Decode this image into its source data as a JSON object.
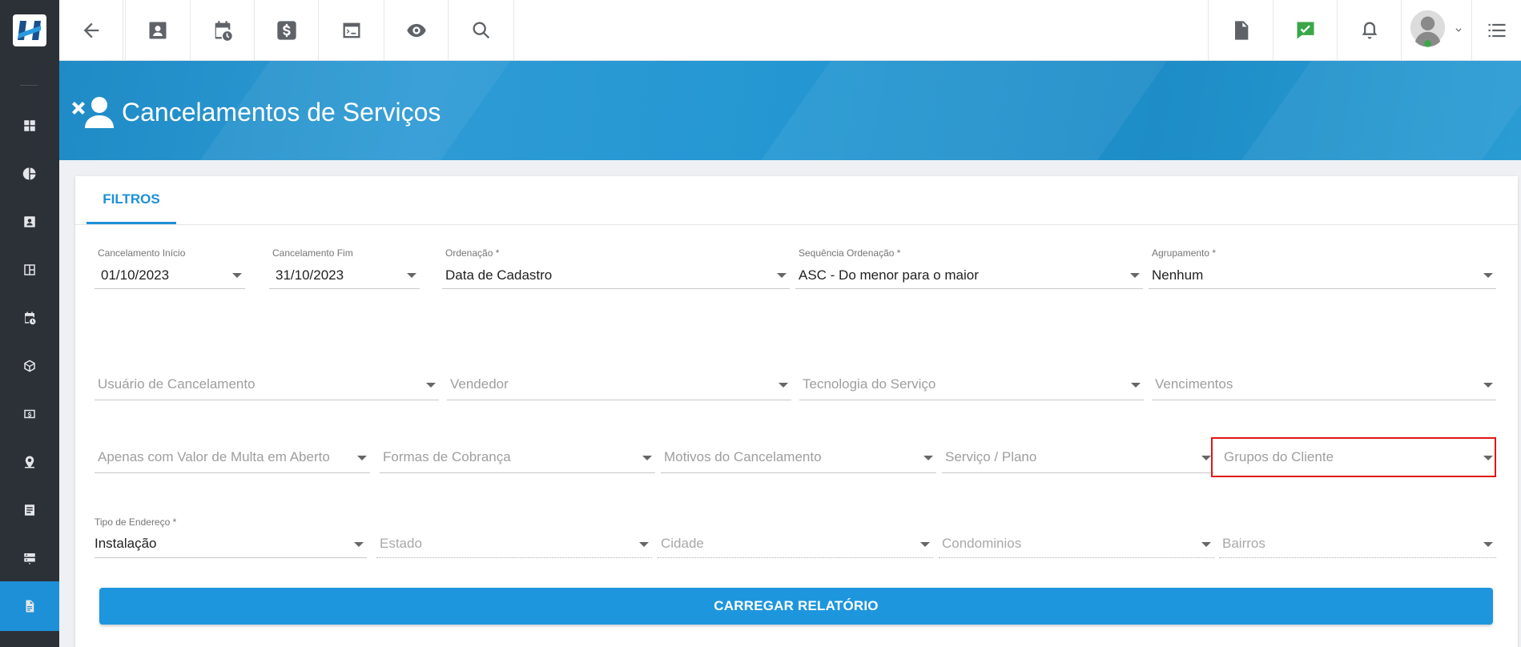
{
  "app": {
    "title": "Cancelamentos de Serviços"
  },
  "topbar": {
    "icons": [
      "back-arrow-icon",
      "contact-card-icon",
      "calendar-clock-icon",
      "dollar-icon",
      "terminal-icon",
      "eye-icon",
      "search-icon",
      "pdf-icon",
      "check-message-icon",
      "bell-icon",
      "avatar",
      "menu-list-icon"
    ]
  },
  "sidebar": {
    "items": [
      "dashboard-icon",
      "pie-chart-icon",
      "contact-card-icon",
      "board-icon",
      "calendar-clock-icon",
      "package-icon",
      "money-icon",
      "location-pin-icon",
      "document-list-icon",
      "server-icon",
      "report-file-icon"
    ],
    "active": "report-file-icon"
  },
  "tabs": {
    "filters": "FILTROS"
  },
  "filters": {
    "row1": {
      "cancel_start": {
        "label": "Cancelamento Início",
        "value": "01/10/2023"
      },
      "cancel_end": {
        "label": "Cancelamento Fim",
        "value": "31/10/2023"
      },
      "ordering": {
        "label": "Ordenação *",
        "value": "Data de Cadastro"
      },
      "order_sequence": {
        "label": "Sequência Ordenação *",
        "value": "ASC - Do menor para o maior"
      },
      "grouping": {
        "label": "Agrupamento *",
        "value": "Nenhum"
      }
    },
    "row2": {
      "cancel_user": "Usuário de Cancelamento",
      "seller": "Vendedor",
      "service_tech": "Tecnologia do Serviço",
      "due_dates": "Vencimentos"
    },
    "row3": {
      "open_fine": "Apenas com Valor de Multa em Aberto",
      "billing_forms": "Formas de Cobrança",
      "cancel_reasons": "Motivos do Cancelamento",
      "service_plan": "Serviço / Plano",
      "client_groups": "Grupos do Cliente"
    },
    "row4": {
      "address_type": {
        "label": "Tipo de Endereço *",
        "value": "Instalação"
      },
      "state": "Estado",
      "city": "Cidade",
      "condos": "Condominios",
      "neighborhoods": "Bairros"
    }
  },
  "actions": {
    "load_report": "CARREGAR RELATÓRIO"
  },
  "colors": {
    "accent": "#1e90d7",
    "sidebar": "#2c3138",
    "highlight": "#e01616"
  }
}
